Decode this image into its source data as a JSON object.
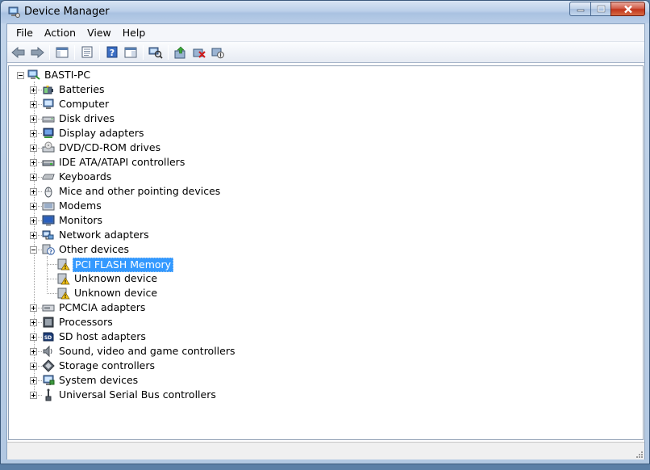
{
  "window": {
    "title": "Device Manager"
  },
  "menu": [
    "File",
    "Action",
    "View",
    "Help"
  ],
  "toolbar": {
    "buttons": [
      {
        "name": "back-icon"
      },
      {
        "name": "forward-icon"
      },
      {
        "name": "show-hide-console-tree-icon"
      },
      {
        "name": "properties-icon"
      },
      {
        "name": "help-icon"
      },
      {
        "name": "show-action-pane-icon"
      },
      {
        "name": "scan-hardware-icon"
      },
      {
        "name": "update-driver-icon"
      },
      {
        "name": "uninstall-icon"
      },
      {
        "name": "disable-device-icon"
      }
    ]
  },
  "tree": {
    "root": "BASTI-PC",
    "categories": [
      {
        "label": "Batteries",
        "icon": "battery-icon"
      },
      {
        "label": "Computer",
        "icon": "computer-icon"
      },
      {
        "label": "Disk drives",
        "icon": "disk-drive-icon"
      },
      {
        "label": "Display adapters",
        "icon": "display-adapter-icon"
      },
      {
        "label": "DVD/CD-ROM drives",
        "icon": "dvd-drive-icon"
      },
      {
        "label": "IDE ATA/ATAPI controllers",
        "icon": "ide-controller-icon"
      },
      {
        "label": "Keyboards",
        "icon": "keyboard-icon"
      },
      {
        "label": "Mice and other pointing devices",
        "icon": "mouse-icon"
      },
      {
        "label": "Modems",
        "icon": "modem-icon"
      },
      {
        "label": "Monitors",
        "icon": "monitor-icon"
      },
      {
        "label": "Network adapters",
        "icon": "network-adapter-icon"
      },
      {
        "label": "Other devices",
        "icon": "other-devices-icon",
        "expanded": true,
        "children": [
          {
            "label": "PCI FLASH Memory",
            "selected": true
          },
          {
            "label": "Unknown device"
          },
          {
            "label": "Unknown device"
          }
        ]
      },
      {
        "label": "PCMCIA adapters",
        "icon": "pcmcia-icon"
      },
      {
        "label": "Processors",
        "icon": "processor-icon"
      },
      {
        "label": "SD host adapters",
        "icon": "sd-host-icon"
      },
      {
        "label": "Sound, video and game controllers",
        "icon": "sound-icon"
      },
      {
        "label": "Storage controllers",
        "icon": "storage-controller-icon"
      },
      {
        "label": "System devices",
        "icon": "system-devices-icon"
      },
      {
        "label": "Universal Serial Bus controllers",
        "icon": "usb-icon"
      }
    ]
  },
  "colors": {
    "selection": "#3399ff",
    "warning": "#f5c518"
  }
}
